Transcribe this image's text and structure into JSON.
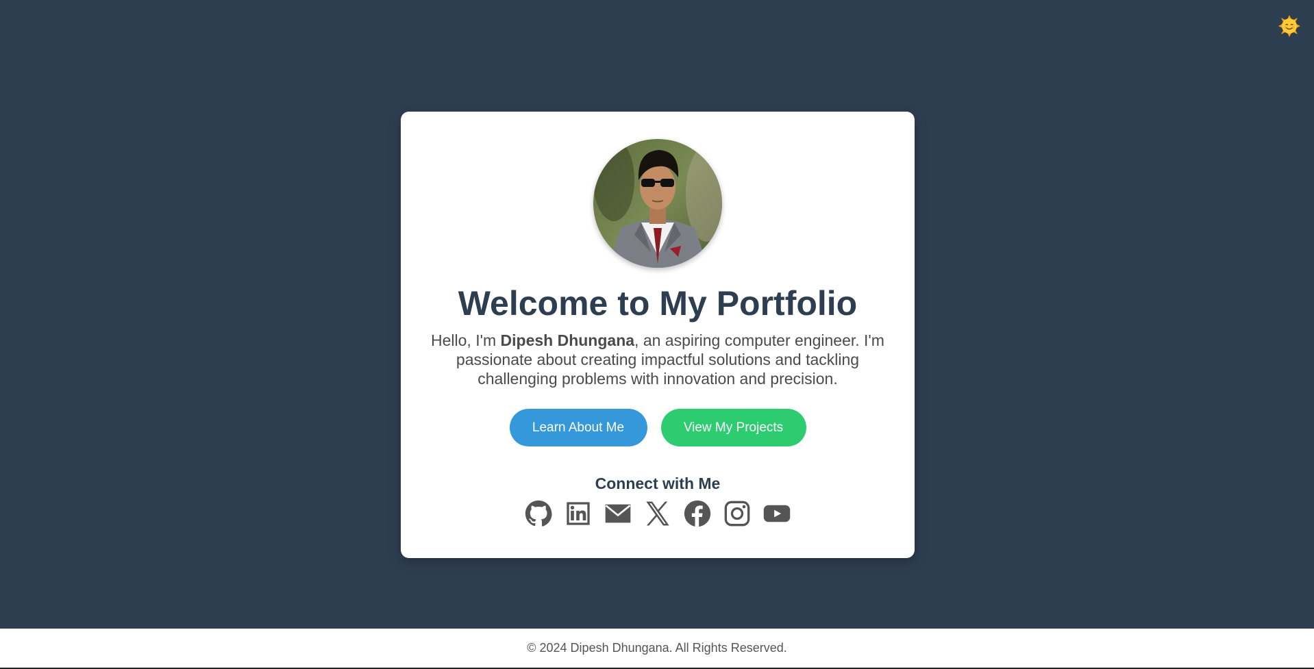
{
  "theme_toggle": {
    "icon": "sun-emoji-icon",
    "glyph": "🌞"
  },
  "hero": {
    "title": "Welcome to My Portfolio",
    "intro_prefix": "Hello, I'm ",
    "name": "Dipesh Dhungana",
    "intro_suffix": ", an aspiring computer engineer. I'm passionate about creating impactful solutions and tackling challenging problems with innovation and precision."
  },
  "buttons": {
    "about_label": "Learn About Me",
    "projects_label": "View My Projects"
  },
  "connect": {
    "title": "Connect with Me",
    "icons": [
      "github-icon",
      "linkedin-icon",
      "email-icon",
      "x-twitter-icon",
      "facebook-icon",
      "instagram-icon",
      "youtube-icon"
    ]
  },
  "footer": {
    "text": "© 2024 Dipesh Dhungana. All Rights Reserved."
  },
  "colors": {
    "background": "#2e3e51",
    "card": "#ffffff",
    "heading": "#2c3e50",
    "about_button": "#3498db",
    "projects_button": "#2ecc71",
    "icon": "#555555"
  }
}
